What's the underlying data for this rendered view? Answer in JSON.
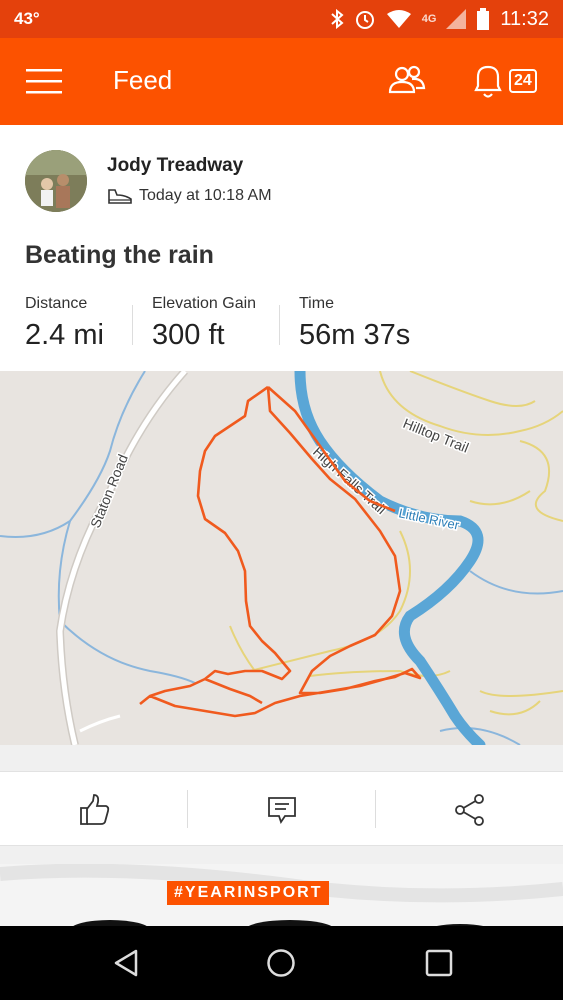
{
  "status_bar": {
    "temperature": "43°",
    "network": "4G",
    "time": "11:32"
  },
  "app_bar": {
    "title": "Feed",
    "notification_count": "24"
  },
  "activity": {
    "athlete_name": "Jody Treadway",
    "date": "Today at 10:18 AM",
    "title": "Beating the rain",
    "stats": [
      {
        "label": "Distance",
        "value": "2.4 mi"
      },
      {
        "label": "Elevation Gain",
        "value": "300 ft"
      },
      {
        "label": "Time",
        "value": "56m 37s"
      }
    ]
  },
  "map": {
    "labels": {
      "road": "Staton Road",
      "hilltop": "Hilltop Trail",
      "high_falls": "High Falls Trail",
      "river": "Little River"
    },
    "colors": {
      "route": "#f05a1e",
      "river": "#5aa6d6",
      "trail": "#e6d47a",
      "land": "#e8e4e0"
    }
  },
  "next_card": {
    "tag": "#YEARINSPORT"
  },
  "colors": {
    "brand": "#fc5200",
    "status_bar": "#e4410c"
  },
  "icons": [
    "menu-icon",
    "people-icon",
    "bell-icon",
    "shoe-icon",
    "like-icon",
    "comment-icon",
    "share-icon",
    "back-icon",
    "home-icon",
    "recents-icon"
  ]
}
